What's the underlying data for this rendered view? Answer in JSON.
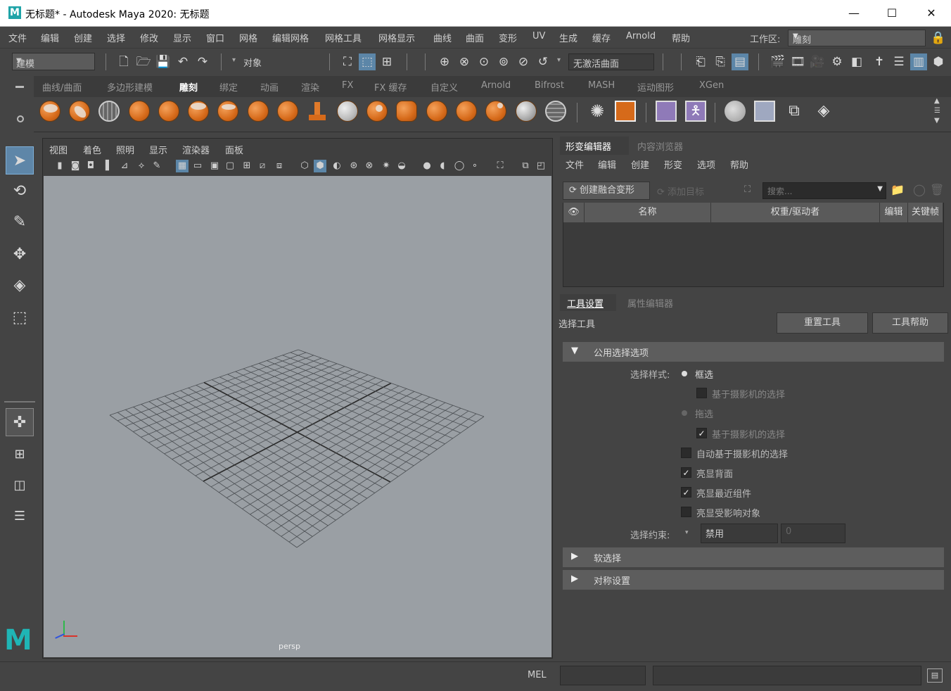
{
  "title_bar": {
    "logo": "M",
    "title": "无标题* - Autodesk Maya 2020: 无标题",
    "minimize": "—",
    "maximize": "☐",
    "close": "✕"
  },
  "menu": [
    "文件",
    "编辑",
    "创建",
    "选择",
    "修改",
    "显示",
    "窗口",
    "网格",
    "编辑网格",
    "网格工具",
    "网格显示",
    "曲线",
    "曲面",
    "变形",
    "UV",
    "生成",
    "缓存",
    "Arnold",
    "帮助"
  ],
  "workspace": {
    "label": "工作区:",
    "value": "雕刻"
  },
  "status_line": {
    "mode": "建模",
    "object_label": "对象",
    "live_surface": "无激活曲面"
  },
  "shelf_tabs": [
    "曲线/曲面",
    "多边形建模",
    "雕刻",
    "绑定",
    "动画",
    "渲染",
    "FX",
    "FX 缓存",
    "自定义",
    "Arnold",
    "Bifrost",
    "MASH",
    "运动图形",
    "XGen"
  ],
  "shelf_active": "雕刻",
  "viewport_menu": [
    "视图",
    "着色",
    "照明",
    "显示",
    "渲染器",
    "面板"
  ],
  "viewport_label": "persp",
  "right_panel": {
    "top_tabs": [
      "形变编辑器",
      "内容浏览器"
    ],
    "top_menu": [
      "文件",
      "编辑",
      "创建",
      "形变",
      "选项",
      "帮助"
    ],
    "create_blend": "创建融合变形",
    "add_target": "添加目标",
    "search_placeholder": "搜索...",
    "columns": [
      "名称",
      "权重/驱动者",
      "编辑",
      "关键帧"
    ],
    "bottom_tabs": [
      "工具设置",
      "属性编辑器"
    ],
    "tool_name": "选择工具",
    "reset_tool": "重置工具",
    "tool_help": "工具帮助",
    "sections": {
      "common": "公用选择选项",
      "soft": "软选择",
      "symmetry": "对称设置"
    },
    "selection_style_label": "选择样式:",
    "marquee": "框选",
    "camera_based_1": "基于摄影机的选择",
    "drag": "拖选",
    "camera_based_2": "基于摄影机的选择",
    "auto_camera": "自动基于摄影机的选择",
    "highlight_backfaces": "亮显背面",
    "highlight_nearest": "亮显最近组件",
    "highlight_affected": "亮显受影响对象",
    "constraint_label": "选择约束:",
    "constraint_value": "禁用",
    "constraint_num": "0"
  },
  "bottom": {
    "mel": "MEL"
  }
}
